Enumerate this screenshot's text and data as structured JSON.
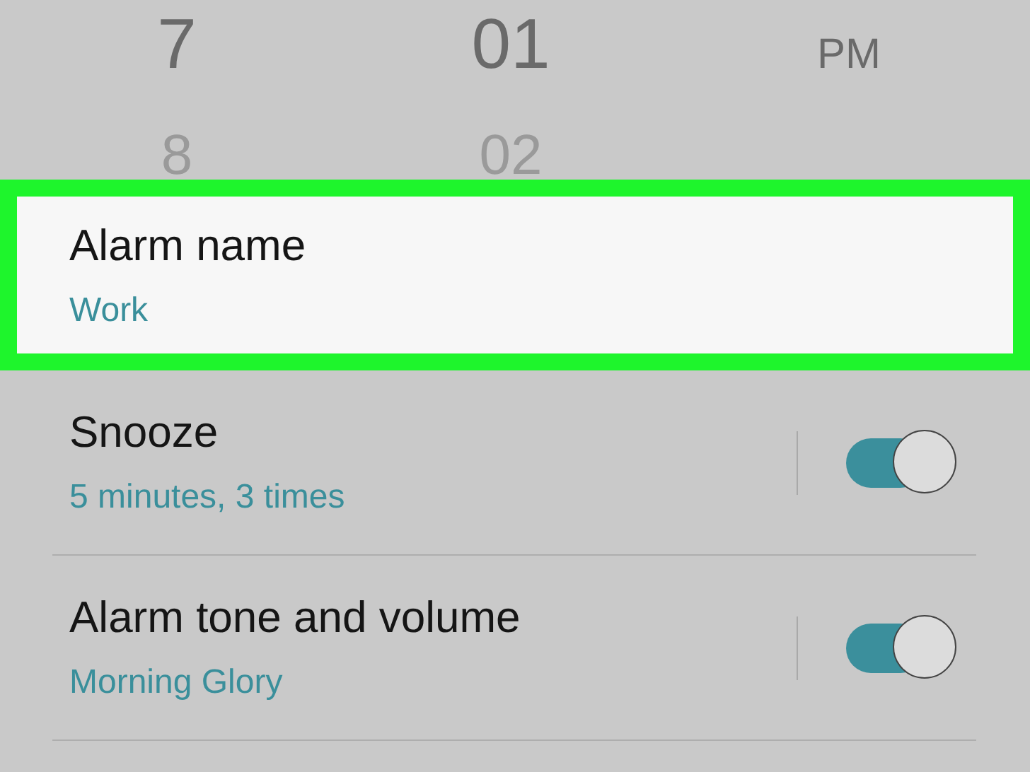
{
  "time_picker": {
    "columns": [
      {
        "current": "7",
        "next": "8"
      },
      {
        "current": "01",
        "next": "02"
      },
      {
        "current": "PM"
      }
    ]
  },
  "settings": [
    {
      "kind": "text",
      "title": "Alarm name",
      "value": "Work",
      "selected": true
    },
    {
      "kind": "toggle",
      "title": "Snooze",
      "value": "5 minutes, 3 times",
      "on": true,
      "selected": false
    },
    {
      "kind": "toggle",
      "title": "Alarm tone and volume",
      "value": "Morning Glory",
      "on": true,
      "selected": false
    }
  ]
}
